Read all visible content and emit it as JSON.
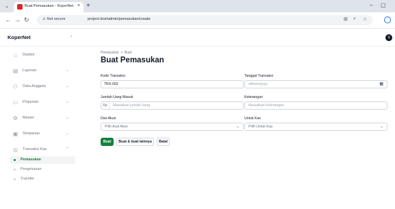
{
  "browser": {
    "tab_title": "Buat Pemasukan - KoperNet",
    "security_label": "Not secure",
    "url": "project.test/admin/pemasukan/create"
  },
  "app": {
    "brand": "KoperNet",
    "avatar_initial": "S"
  },
  "sidebar": {
    "items": [
      {
        "label": "Dasbor",
        "icon": "home-icon",
        "has_chevron": false
      },
      {
        "label": "Laporan",
        "icon": "document-icon",
        "has_chevron": true
      },
      {
        "label": "Data Anggota",
        "icon": "users-icon",
        "has_chevron": true
      },
      {
        "label": "Pinjaman",
        "icon": "banknote-icon",
        "has_chevron": true
      },
      {
        "label": "Master",
        "icon": "gear-icon",
        "has_chevron": true
      },
      {
        "label": "Simpanan",
        "icon": "wallet-icon",
        "has_chevron": true
      },
      {
        "label": "Transaksi Kas",
        "icon": "currency-icon",
        "has_chevron": true
      }
    ],
    "sub_items": [
      {
        "label": "Pemasukan",
        "active": true
      },
      {
        "label": "Pengeluaran",
        "active": false
      },
      {
        "label": "Transfer",
        "active": false
      }
    ]
  },
  "page": {
    "breadcrumb_parent": "Pemasukan",
    "breadcrumb_sep": ">",
    "breadcrumb_current": "Buat",
    "title": "Buat Pemasukan"
  },
  "form": {
    "kode": {
      "label": "Kode Transaksi",
      "value": "TRX-002"
    },
    "tanggal": {
      "label": "Tanggal Transaksi",
      "placeholder": "dd/mm/yyyy"
    },
    "jumlah": {
      "label": "Jumlah Uang Masuk",
      "prefix": "Rp",
      "placeholder": "Masukkan jumlah Uang"
    },
    "keterangan": {
      "label": "Keterangan",
      "placeholder": "Masukkan Keterangan"
    },
    "dari_akun": {
      "label": "Dari Akun",
      "placeholder": "Pilih Asal Akun"
    },
    "untuk_kas": {
      "label": "Untuk Kas",
      "placeholder": "Pilih Untuk Kas"
    }
  },
  "actions": {
    "create": "Buat",
    "create_another": "Buat & buat lainnya",
    "cancel": "Batal"
  },
  "colors": {
    "accent": "#15803d",
    "danger": "#dc2626"
  }
}
